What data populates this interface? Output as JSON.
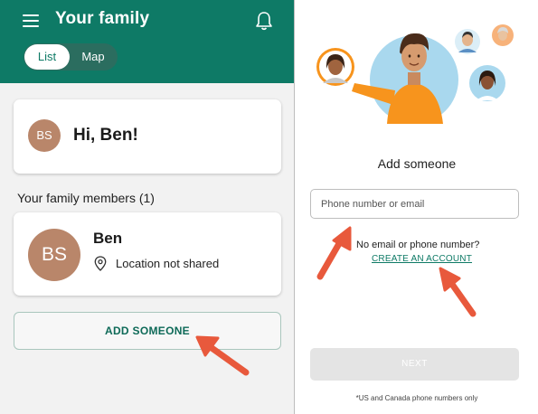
{
  "left": {
    "header": {
      "title": "Your family",
      "toggle_list": "List",
      "toggle_map": "Map"
    },
    "greeting": {
      "initials": "BS",
      "text": "Hi, Ben!"
    },
    "members_title": "Your family members (1)",
    "member": {
      "initials": "BS",
      "name": "Ben",
      "status": "Location not shared"
    },
    "add_button": "ADD SOMEONE"
  },
  "right": {
    "title": "Add someone",
    "input_placeholder": "Phone number or email",
    "no_email_text": "No email or phone number?",
    "create_account": "CREATE AN ACCOUNT",
    "next_button": "NEXT",
    "footnote": "*US and Canada phone numbers only"
  },
  "colors": {
    "header_green": "#0e7a66",
    "avatar_tan": "#b9866a",
    "annotation_arrow": "#e8593c"
  }
}
